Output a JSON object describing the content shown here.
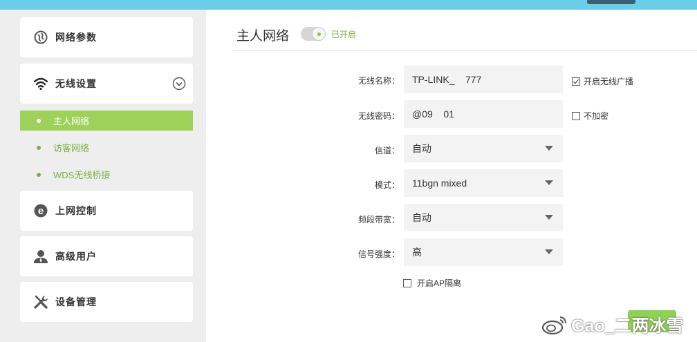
{
  "sidebar": {
    "items": [
      {
        "label": "网络参数",
        "icon": "globe-icon"
      },
      {
        "label": "无线设置",
        "icon": "wifi-icon",
        "expanded": true
      },
      {
        "label": "上网控制",
        "icon": "ie-icon"
      },
      {
        "label": "高级用户",
        "icon": "user-icon"
      },
      {
        "label": "设备管理",
        "icon": "tools-icon"
      }
    ],
    "sub_items": [
      {
        "label": "主人网络",
        "active": true
      },
      {
        "label": "访客网络",
        "active": false
      },
      {
        "label": "WDS无线桥接",
        "active": false
      }
    ]
  },
  "header": {
    "title": "主人网络",
    "toggle_status": "已开启",
    "toggle_on": true,
    "help": "?"
  },
  "form": {
    "ssid_label": "无线名称：",
    "ssid_value": "TP-LINK_    777",
    "broadcast_label": "开启无线广播",
    "broadcast_checked": true,
    "password_label": "无线密码：",
    "password_value": "@09    01",
    "no_encrypt_label": "不加密",
    "no_encrypt_checked": false,
    "channel_label": "信道：",
    "channel_value": "自动",
    "mode_label": "模式：",
    "mode_value": "11bgn mixed",
    "bandwidth_label": "频段带宽：",
    "bandwidth_value": "自动",
    "signal_label": "信号强度：",
    "signal_value": "高",
    "ap_isolation_label": "开启AP隔离",
    "ap_isolation_checked": false
  },
  "watermark": "Gao_二两冰雪",
  "colors": {
    "top_bar": "#6ccde9",
    "accent_green": "#9dd15a",
    "text_green": "#79b142",
    "help_blue": "#4ba3d9"
  }
}
